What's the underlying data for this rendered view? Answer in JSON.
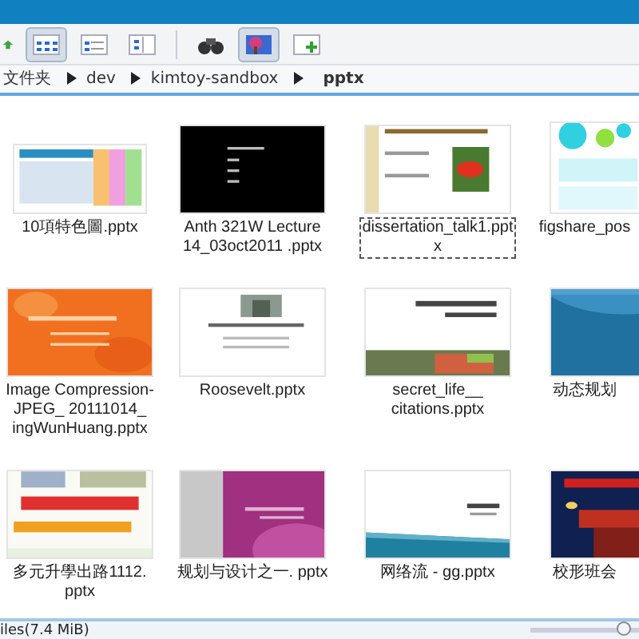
{
  "toolbar": [
    {
      "kind": "up",
      "selected": false
    },
    {
      "kind": "icons",
      "selected": true
    },
    {
      "kind": "details",
      "selected": false
    },
    {
      "kind": "tree",
      "selected": false
    },
    {
      "kind": "find",
      "selected": false
    },
    {
      "kind": "preview",
      "selected": true
    },
    {
      "kind": "newtab",
      "selected": false
    }
  ],
  "breadcrumb": [
    {
      "label": "文件夹",
      "selected": false
    },
    {
      "label": "dev",
      "selected": false
    },
    {
      "label": "kimtoy-sandbox",
      "selected": false
    },
    {
      "label": "pptx",
      "selected": true
    }
  ],
  "files": [
    {
      "name": "10項特色圖.pptx",
      "focused": false
    },
    {
      "name": "Anth 321W Lecture 14_03oct2011 .pptx",
      "focused": false
    },
    {
      "name": "dissertation_talk1.pptx",
      "focused": true
    },
    {
      "name": "figshare_pos",
      "focused": false
    },
    {
      "name": "Image Compression-JPEG_ 20111014_ ingWunHuang.pptx",
      "focused": false
    },
    {
      "name": "Roosevelt.pptx",
      "focused": false
    },
    {
      "name": "secret_life__ citations.pptx",
      "focused": false
    },
    {
      "name": "动态规划",
      "focused": false
    },
    {
      "name": "多元升學出路1112. pptx",
      "focused": false
    },
    {
      "name": "规划与设计之一. pptx",
      "focused": false
    },
    {
      "name": "网络流 - gg.pptx",
      "focused": false
    },
    {
      "name": "校形班会",
      "focused": false
    }
  ],
  "status_bar": {
    "text": "iles(7.4 MiB)",
    "zoom": {
      "level": 0.72
    }
  }
}
